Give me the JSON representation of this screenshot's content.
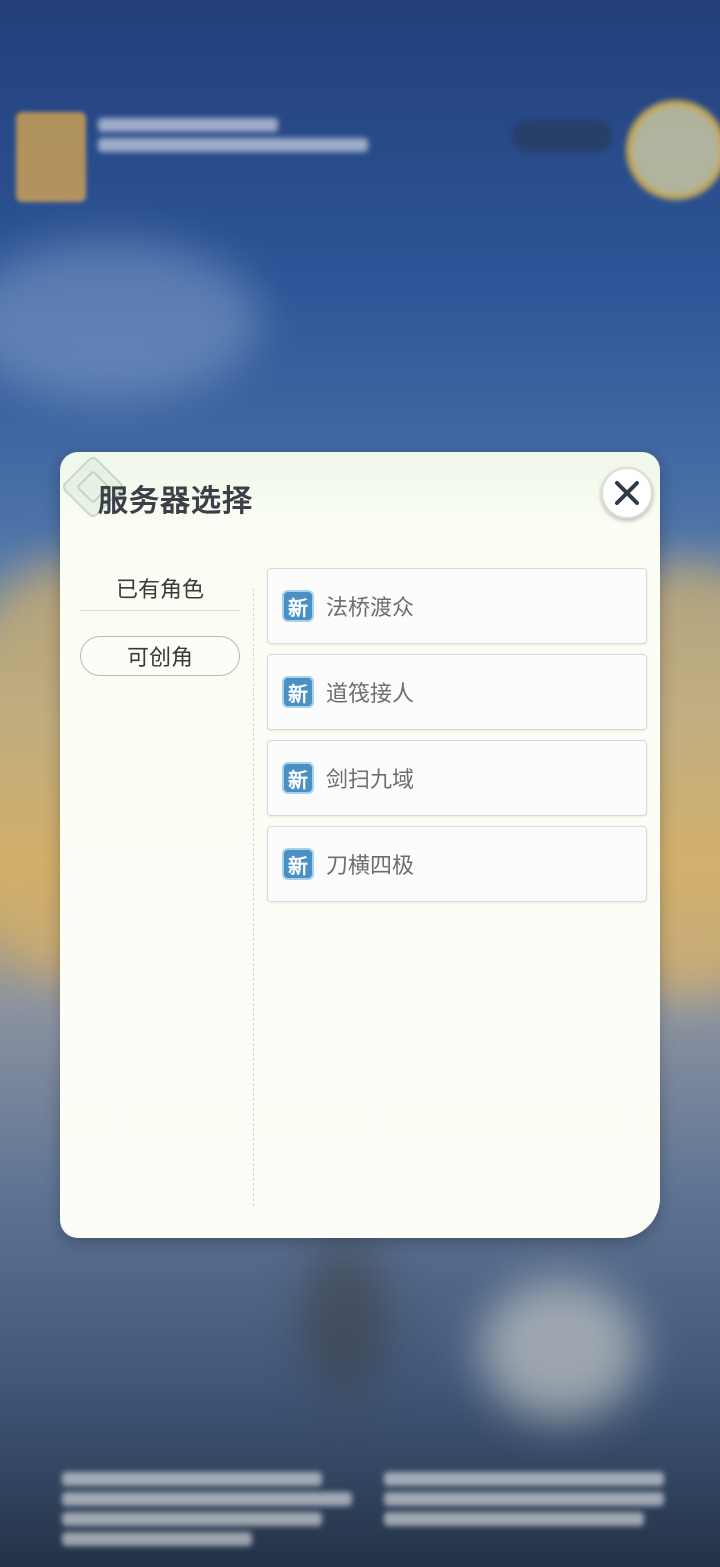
{
  "dialog": {
    "title": "服务器选择",
    "close_icon": "close-icon"
  },
  "tabs": {
    "owned": "已有角色",
    "create": "可创角"
  },
  "servers": [
    {
      "badge": "新",
      "name": "法桥渡众"
    },
    {
      "badge": "新",
      "name": "道筏接人"
    },
    {
      "badge": "新",
      "name": "剑扫九域"
    },
    {
      "badge": "新",
      "name": "刀横四极"
    }
  ],
  "colors": {
    "badge_blue": "#4a90c5",
    "title_text": "#3b3f47"
  }
}
